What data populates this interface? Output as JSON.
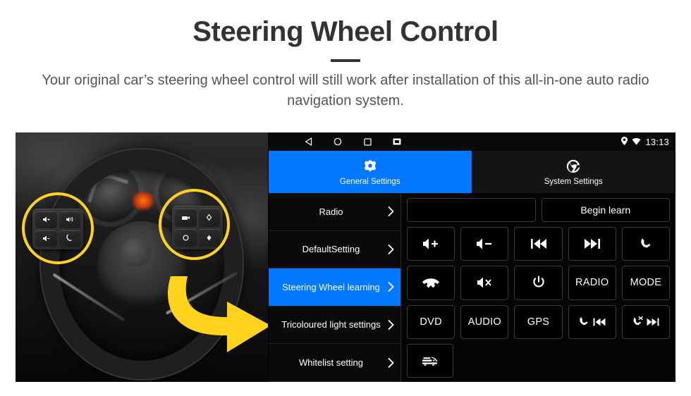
{
  "header": {
    "title": "Steering Wheel Control",
    "subtitle": "Your original car’s steering wheel control will still work after installation of this all-in-one auto radio navigation system."
  },
  "colors": {
    "accent_blue": "#0277FF",
    "highlight_yellow": "#FFD21E",
    "title_gray": "#333333",
    "subtitle_gray": "#555555",
    "screen_black": "#000000"
  },
  "photo": {
    "alt": "grayscale photo of a car steering wheel with two yellow circles highlighting the left and right control button clusters and a yellow arrow pointing to the head unit screen",
    "left_cluster_keys": [
      "volume-up-plus",
      "voice-command",
      "volume-down-minus",
      "phone-call"
    ],
    "right_cluster_keys": [
      "media-source",
      "seek-up",
      "mode-circle",
      "seek-down"
    ]
  },
  "device": {
    "statusbar": {
      "nav_icons": [
        "back-icon",
        "home-icon",
        "recents-icon",
        "screenshot-icon"
      ],
      "status_icons": [
        "location-pin-icon",
        "wifi-icon"
      ],
      "time": "13:13"
    },
    "tabs": [
      {
        "label": "General Settings",
        "icon": "gear-icon",
        "active": true
      },
      {
        "label": "System Settings",
        "icon": "system-settings-icon",
        "active": false
      }
    ],
    "menu": [
      {
        "label": "Radio",
        "selected": false
      },
      {
        "label": "DefaultSetting",
        "selected": false
      },
      {
        "label": "Steering Wheel learning",
        "selected": true
      },
      {
        "label": "Tricoloured light settings",
        "selected": false
      },
      {
        "label": "Whitelist setting",
        "selected": false
      }
    ],
    "panel": {
      "learn_input_value": "",
      "learn_input_placeholder": "",
      "begin_learn_label": "Begin learn",
      "keys": [
        [
          {
            "icon": "volume-up-icon",
            "label": ""
          },
          {
            "icon": "volume-down-icon",
            "label": ""
          },
          {
            "icon": "previous-track-icon",
            "label": ""
          },
          {
            "icon": "next-track-icon",
            "label": ""
          },
          {
            "icon": "phone-answer-icon",
            "label": ""
          }
        ],
        [
          {
            "icon": "phone-hangup-icon",
            "label": ""
          },
          {
            "icon": "mute-icon",
            "label": ""
          },
          {
            "icon": "power-icon",
            "label": ""
          },
          {
            "icon": "",
            "label": "RADIO"
          },
          {
            "icon": "",
            "label": "MODE"
          }
        ],
        [
          {
            "icon": "",
            "label": "DVD"
          },
          {
            "icon": "",
            "label": "AUDIO"
          },
          {
            "icon": "",
            "label": "GPS"
          },
          {
            "icon": "phone-previous-icon",
            "label": ""
          },
          {
            "icon": "phone-reject-next-icon",
            "label": ""
          }
        ],
        [
          {
            "icon": "car-icon",
            "label": ""
          }
        ]
      ]
    }
  }
}
